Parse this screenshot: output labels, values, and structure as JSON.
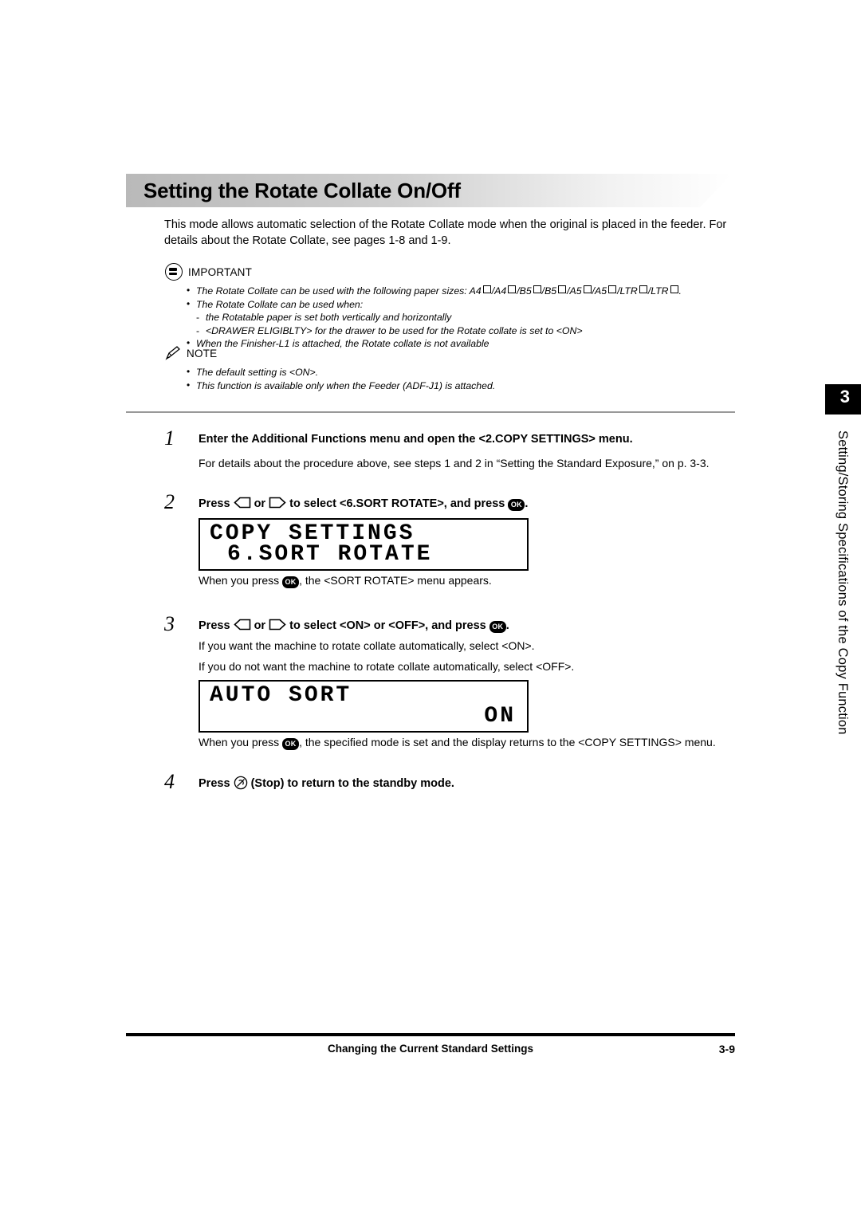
{
  "title": "Setting the Rotate Collate On/Off",
  "intro": "This mode allows automatic selection of the Rotate Collate mode when the original is placed in the feeder. For details about the Rotate Collate, see pages 1-8 and 1-9.",
  "important": {
    "label": "IMPORTANT",
    "bullets": [
      "The Rotate Collate can be used with the following paper sizes: A4 /A4 /B5 /B5 /A5 /A5 /LTR /LTR .",
      "The Rotate Collate can be used when:",
      "the Rotatable paper is set both vertically and horizontally",
      "<DRAWER ELIGIBLTY> for the drawer to be used for the Rotate collate is set to <ON>",
      "When the Finisher-L1 is attached, the Rotate collate is not available"
    ],
    "paper_sizes_prefix": "The Rotate Collate can be used with the following paper sizes: A4",
    "paper_sizes_parts": [
      "/A4",
      "/B5",
      "/B5",
      "/A5",
      "/A5",
      "/LTR",
      "/LTR"
    ],
    "paper_sizes_suffix": "."
  },
  "note": {
    "label": "NOTE",
    "bullets": [
      "The default setting is <ON>.",
      "This function is available only when the Feeder (ADF-J1) is attached."
    ]
  },
  "side_tab": {
    "number": "3",
    "text": "Setting/Storing Specifications of the Copy Function"
  },
  "steps": [
    {
      "num": "1",
      "head": "Enter the Additional Functions menu and open the <2.COPY SETTINGS> menu.",
      "body": "For details about the procedure above, see steps 1 and 2 in “Setting the Standard Exposure,” on p. 3-3."
    },
    {
      "num": "2",
      "head_pre": "Press",
      "head_mid": "or",
      "head_post": "to select <6.SORT ROTATE>, and press",
      "head_end": ".",
      "caption_pre": "When you press",
      "caption_post": ", the <SORT ROTATE> menu appears."
    },
    {
      "num": "3",
      "head_pre": "Press",
      "head_mid": "or",
      "head_post": "to select <ON> or <OFF>, and press",
      "head_end": ".",
      "body1": "If you want the machine to rotate collate automatically, select <ON>.",
      "body2": "If you do not want the machine to rotate collate automatically, select <OFF>.",
      "caption_pre": "When you press",
      "caption_post": ", the specified mode is set and the display returns to the <COPY SETTINGS> menu."
    },
    {
      "num": "4",
      "head_pre": "Press",
      "head_post": "(Stop) to return to the standby mode."
    }
  ],
  "lcd1": {
    "line1": "COPY SETTINGS",
    "line2": "6.SORT ROTATE"
  },
  "lcd2": {
    "line1": "AUTO SORT",
    "line2": "ON"
  },
  "keys": {
    "ok_label": "OK"
  },
  "footer": {
    "text": "Changing the Current Standard Settings",
    "page": "3-9"
  }
}
